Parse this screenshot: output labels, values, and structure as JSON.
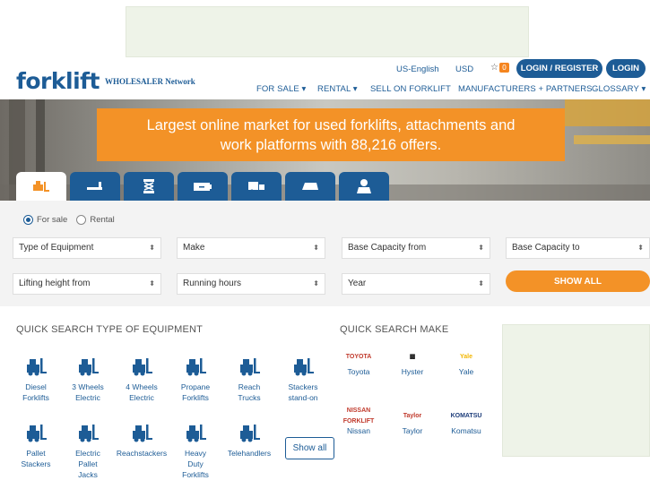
{
  "header": {
    "logo_text": "forklift",
    "logo_sub": "WHOLESALER Network",
    "language": "US-English",
    "currency": "USD",
    "favorites_count": "0",
    "login_register_label": "LOGIN / REGISTER",
    "login_label": "LOGIN"
  },
  "nav": {
    "for_sale": "FOR SALE ▾",
    "rental": "RENTAL ▾",
    "sell": "SELL ON FORKLIFT",
    "manufacturers": "MANUFACTURERS + PARTNERS",
    "glossary": "GLOSSARY ▾"
  },
  "hero": {
    "line1": "Largest online market for used forklifts, attachments and",
    "line2": "work platforms with 88,216 offers."
  },
  "search": {
    "radio_sale": "For sale",
    "radio_rental": "Rental",
    "type_of_equipment": "Type of Equipment",
    "make": "Make",
    "capacity_from": "Base Capacity from",
    "capacity_to": "Base Capacity to",
    "lifting_height_from": "Lifting height from",
    "running_hours": "Running hours",
    "year": "Year",
    "show_all": "SHOW ALL"
  },
  "quick_equipment": {
    "title": "QUICK SEARCH TYPE OF EQUIPMENT",
    "items": [
      {
        "label": "Diesel\nForklifts"
      },
      {
        "label": "3 Wheels\nElectric"
      },
      {
        "label": "4 Wheels\nElectric"
      },
      {
        "label": "Propane\nForklifts"
      },
      {
        "label": "Reach\nTrucks"
      },
      {
        "label": "Stackers\nstand-on"
      },
      {
        "label": "Pallet\nStackers"
      },
      {
        "label": "Electric\nPallet\nJacks"
      },
      {
        "label": "Reachstackers"
      },
      {
        "label": "Heavy\nDuty\nForklifts"
      },
      {
        "label": "Telehandlers"
      }
    ],
    "show_all": "Show all"
  },
  "quick_make": {
    "title": "QUICK SEARCH MAKE",
    "items": [
      {
        "logo": "TOYOTA",
        "label": "Toyota",
        "color": "#c0392b"
      },
      {
        "logo": "▩",
        "label": "Hyster",
        "color": "#1a1a1a"
      },
      {
        "logo": "Yale",
        "label": "Yale",
        "color": "#f2b705"
      },
      {
        "logo": "NISSAN FORKLIFT",
        "label": "Nissan",
        "color": "#c0392b"
      },
      {
        "logo": "Taylor",
        "label": "Taylor",
        "color": "#c0392b"
      },
      {
        "logo": "KOMATSU",
        "label": "Komatsu",
        "color": "#1d3d7a"
      }
    ]
  },
  "colors": {
    "brand_blue": "#1d5c96",
    "accent_orange": "#f39227"
  }
}
